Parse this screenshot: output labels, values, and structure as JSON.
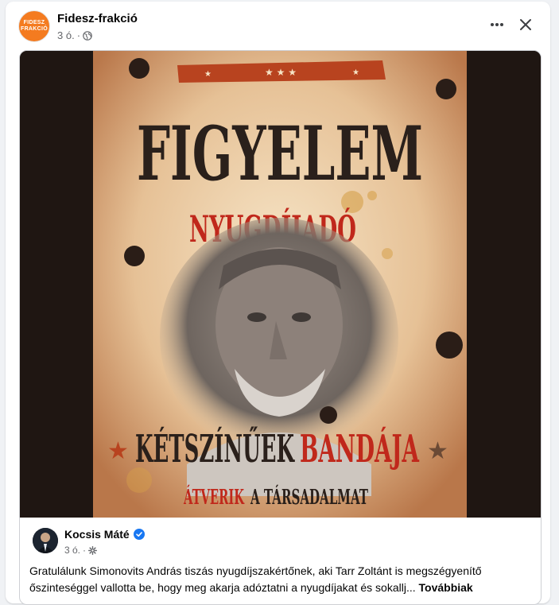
{
  "post": {
    "page_name": "Fidesz-frakció",
    "time": "3 ó.",
    "dot": "·",
    "avatar_text_top": "FIDESZ",
    "avatar_text_bottom": "FRAKCIÓ",
    "privacy_icon": "globe-icon",
    "actions": [
      "more-options-icon",
      "close-icon"
    ]
  },
  "poster": {
    "headline": "FIGYELEM",
    "subheadline": "NYUGDÍJADÓ",
    "banner_word_1": "KÉTSZÍNŰEK",
    "banner_word_2": "BANDÁJA",
    "bottom_word_1": "ÁTVERIK",
    "bottom_word_2": "A TÁRSADALMAT",
    "stars": "★ ★ ★",
    "colors": {
      "paper": "#e9c79d",
      "dark_text": "#2a201b",
      "red_text": "#c0281b",
      "ribbon": "#b8431f",
      "side_bars": "#1f1612"
    }
  },
  "shared_post": {
    "author": "Kocsis Máté",
    "time": "3 ó.",
    "dot": "·",
    "privacy_icon": "gear-icon",
    "verified_icon": "verified-badge-icon",
    "text": "Gratulálunk Simonovits András tiszás nyugdíjszakértőnek, aki Tarr Zoltánt is megszégyenítő őszinteséggel vallotta be, hogy meg akarja adóztatni a nyugdíjakat és sokallj...",
    "see_more": "Továbbiak"
  }
}
